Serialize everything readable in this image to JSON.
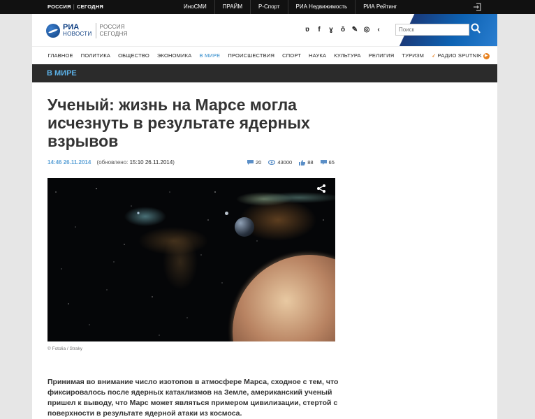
{
  "topbar": {
    "brand_left": "РОССИЯ",
    "brand_right": "СЕГОДНЯ",
    "links": [
      {
        "label": "ИноСМИ"
      },
      {
        "label": "ПРАЙМ"
      },
      {
        "label": "Р-Спорт"
      },
      {
        "label": "РИА Недвижимость"
      },
      {
        "label": "РИА Рейтинг"
      }
    ]
  },
  "header": {
    "logo_ria": "РИА",
    "logo_novosti": "НОВОСТИ",
    "logo_rs_line1": "РОССИЯ",
    "logo_rs_line2": "СЕГОДНЯ",
    "social_icons": [
      "vk-icon",
      "facebook-icon",
      "twitter-icon",
      "odnoklassniki-icon",
      "livejournal-icon",
      "instagram-icon",
      "share-icon"
    ],
    "search_placeholder": "Поиск"
  },
  "nav": {
    "items": [
      {
        "label": "ГЛАВНОЕ"
      },
      {
        "label": "ПОЛИТИКА"
      },
      {
        "label": "ОБЩЕСТВО"
      },
      {
        "label": "ЭКОНОМИКА"
      },
      {
        "label": "В МИРЕ"
      },
      {
        "label": "ПРОИСШЕСТВИЯ"
      },
      {
        "label": "СПОРТ"
      },
      {
        "label": "НАУКА"
      },
      {
        "label": "КУЛЬТУРА"
      },
      {
        "label": "РЕЛИГИЯ"
      },
      {
        "label": "ТУРИЗМ"
      }
    ],
    "active_index": 4,
    "radio_label": "РАДИО SPUTNIK"
  },
  "section": {
    "title": "В МИРЕ"
  },
  "article": {
    "title": "Ученый: жизнь на Марсе могла исчезнуть в результате ядерных взрывов",
    "time": "14:46",
    "date": "26.11.2014",
    "updated_prefix": "(обновлено: ",
    "updated_value": "15:10 26.11.2014",
    "updated_suffix": ")",
    "stats": {
      "comments": "20",
      "views": "43000",
      "likes": "88",
      "shares": "65"
    },
    "image_caption": "© Fotolia / Straky",
    "lead": "Принимая во внимание число изотопов в атмосфере Марса, сходное с тем, что фиксировалось после ядерных катаклизмов на Земле, американский ученый пришел к выводу, что Марс может являться примером цивилизации, стертой с поверхности в результате ядерной атаки из космоса."
  },
  "colors": {
    "accent_blue": "#2e8acb",
    "section_bg": "#2b2b2b",
    "radio_orange": "#e8811e"
  }
}
